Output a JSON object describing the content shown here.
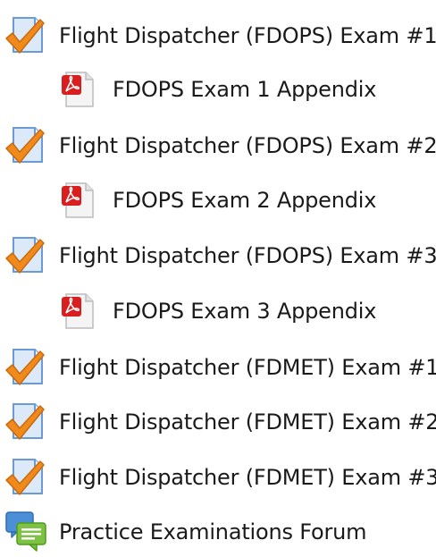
{
  "activities": [
    {
      "type": "quiz",
      "icon": "quiz-checkmark-icon",
      "label": "Flight Dispatcher (FDOPS) Exam #1"
    },
    {
      "type": "pdf",
      "icon": "pdf-file-icon",
      "label": "FDOPS Exam 1 Appendix"
    },
    {
      "type": "quiz",
      "icon": "quiz-checkmark-icon",
      "label": "Flight Dispatcher (FDOPS) Exam #2"
    },
    {
      "type": "pdf",
      "icon": "pdf-file-icon",
      "label": "FDOPS Exam 2 Appendix"
    },
    {
      "type": "quiz",
      "icon": "quiz-checkmark-icon",
      "label": "Flight Dispatcher (FDOPS) Exam #3"
    },
    {
      "type": "pdf",
      "icon": "pdf-file-icon",
      "label": "FDOPS Exam 3 Appendix"
    },
    {
      "type": "quiz",
      "icon": "quiz-checkmark-icon",
      "label": "Flight Dispatcher (FDMET) Exam #1"
    },
    {
      "type": "quiz",
      "icon": "quiz-checkmark-icon",
      "label": "Flight Dispatcher (FDMET) Exam #2"
    },
    {
      "type": "quiz",
      "icon": "quiz-checkmark-icon",
      "label": "Flight Dispatcher (FDMET) Exam #3"
    },
    {
      "type": "forum",
      "icon": "forum-chat-icon",
      "label": "Practice Examinations Forum"
    }
  ],
  "colors": {
    "quiz_page_fill": "#dbe9f9",
    "quiz_page_stroke": "#6b9bd6",
    "check_orange": "#f08a1c",
    "pdf_red": "#d81e1e",
    "forum_blue": "#4d8fd6",
    "forum_green": "#7dc242"
  }
}
